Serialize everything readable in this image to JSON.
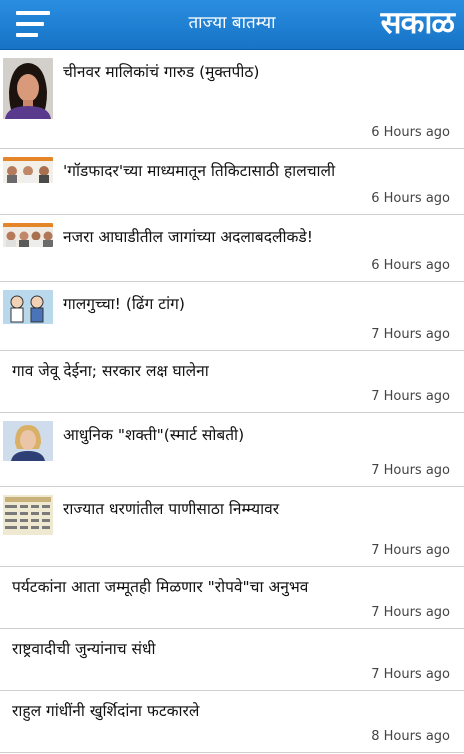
{
  "header": {
    "title": "ताज्या बातम्या",
    "brand": "सकाळ",
    "accent": "#1a7bd0"
  },
  "articles": [
    {
      "headline": "चीनवर मालिकांचं गारुड (मुक्तपीठ)",
      "time": "6 Hours ago",
      "thumbnail": "portrait-woman"
    },
    {
      "headline": "'गॉडफादर'च्या माध्यमातून तिकिटासाठी हालचाली",
      "time": "6 Hours ago",
      "thumbnail": "group-portraits"
    },
    {
      "headline": "नजरा आघाडीतील जागांच्या अदलाबदलीकडे!",
      "time": "6 Hours ago",
      "thumbnail": "group-portraits"
    },
    {
      "headline": "गालगुच्चा! (ढिंग टांग)",
      "time": "7 Hours ago",
      "thumbnail": "cartoon"
    },
    {
      "headline": "गाव जेवू देईना; सरकार लक्ष घालेना",
      "time": "7 Hours ago",
      "thumbnail": ""
    },
    {
      "headline": "आधुनिक \"शक्ती\"(स्मार्ट सोबती)",
      "time": "7 Hours ago",
      "thumbnail": "portrait-woman"
    },
    {
      "headline": "राज्यात धरणांतील पाणीसाठा निम्म्यावर",
      "time": "7 Hours ago",
      "thumbnail": "data-table"
    },
    {
      "headline": "पर्यटकांना आता जम्मूतही मिळणार \"रोपवे\"चा अनुभव",
      "time": "7 Hours ago",
      "thumbnail": ""
    },
    {
      "headline": "राष्ट्रवादीची जुन्यांनाच संधी",
      "time": "7 Hours ago",
      "thumbnail": ""
    },
    {
      "headline": "राहुल गांधींनी खुर्शिदांना फटकारले",
      "time": "8 Hours ago",
      "thumbnail": ""
    }
  ]
}
